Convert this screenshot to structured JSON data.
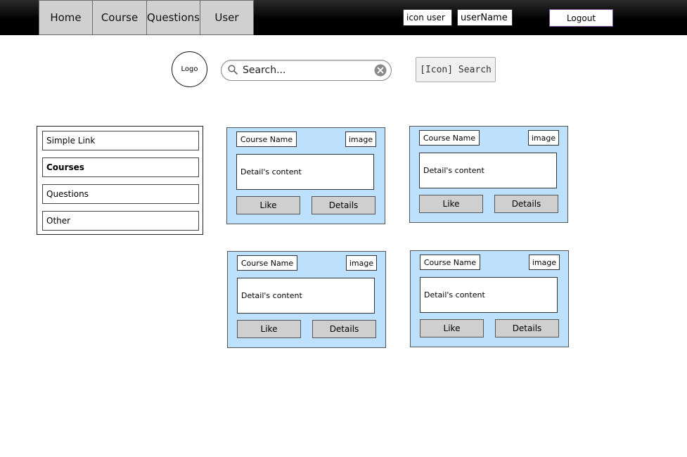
{
  "nav": {
    "tabs": [
      {
        "label": "Home"
      },
      {
        "label": "Course"
      },
      {
        "label": "Questions"
      },
      {
        "label": "User"
      }
    ]
  },
  "top": {
    "icon_user": "icon user",
    "username": "userName",
    "logout_label": "Logout"
  },
  "header": {
    "logo_text": "Logo",
    "search_placeholder": "Search...",
    "search_button_label": "[Icon] Search"
  },
  "sidebar": {
    "items": [
      {
        "label": "Simple Link"
      },
      {
        "label": "Courses"
      },
      {
        "label": "Questions"
      },
      {
        "label": "Other"
      }
    ]
  },
  "cards": [
    {
      "name": "Course Name",
      "image": "image",
      "content": "Detail's content",
      "like": "Like",
      "details": "Details"
    },
    {
      "name": "Course Name",
      "image": "image",
      "content": "Detail's content",
      "like": "Like",
      "details": "Details"
    },
    {
      "name": "Course Name",
      "image": "image",
      "content": "Detail's content",
      "like": "Like",
      "details": "Details"
    },
    {
      "name": "Course Name",
      "image": "image",
      "content": "Detail's content",
      "like": "Like",
      "details": "Details"
    }
  ],
  "colors": {
    "card_bg": "#bde0fd",
    "button_bg": "#cfcfcf",
    "topbar_bg": "#000000",
    "logout_border": "#7a4d9a"
  }
}
